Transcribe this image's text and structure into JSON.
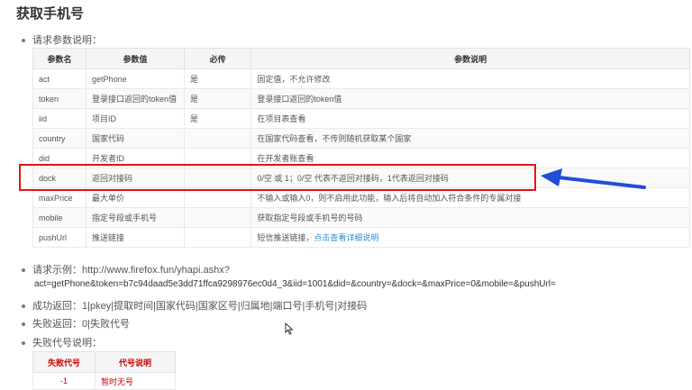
{
  "page_title": "获取手机号",
  "request_params_label": "请求参数说明：",
  "params_table": {
    "headers": [
      "参数名",
      "参数值",
      "必传",
      "参数说明"
    ],
    "rows": [
      {
        "name": "act",
        "value": "getPhone",
        "required": "是",
        "desc": "固定值，不允许修改"
      },
      {
        "name": "token",
        "value": "登录接口返回的token值",
        "required": "是",
        "desc": "登录接口返回的token值"
      },
      {
        "name": "iid",
        "value": "项目ID",
        "required": "是",
        "desc": "在项目表查看"
      },
      {
        "name": "country",
        "value": "国家代码",
        "required": "",
        "desc": "在国家代码查看，不传则随机获取某个国家"
      },
      {
        "name": "did",
        "value": "开发者ID",
        "required": "",
        "desc": "在开发者账查看"
      },
      {
        "name": "dock",
        "value": "返回对接码",
        "required": "",
        "desc": "0/空 或 1；0/空 代表不返回对接码，1代表返回对接码"
      },
      {
        "name": "maxPrice",
        "value": "最大单价",
        "required": "",
        "desc": "不输入或输入0，则不启用此功能，输入后将自动加入符合条件的专属对接"
      },
      {
        "name": "mobile",
        "value": "指定号段或手机号",
        "required": "",
        "desc": "获取指定号段或手机号的号码"
      },
      {
        "name": "pushUrl",
        "value": "推送链接",
        "required": "",
        "desc": "短信推送链接，",
        "link": "点击查看详细说明"
      }
    ]
  },
  "request_example_label": "请求示例：http://www.firefox.fun/yhapi.ashx?",
  "request_example_url": "act=getPhone&token=b7c94daad5e3dd71ffca9298976ec0d4_3&iid=1001&did=&country=&dock=&maxPrice=0&mobile=&pushUrl=",
  "success_return": "成功返回：1|pkey|提取时间|国家代码|国家区号|归属地|端口号|手机号|对接码",
  "failure_return": "失败返回：0|失败代号",
  "failure_code_label": "失败代号说明：",
  "fail_table": {
    "headers": [
      "失败代号",
      "代号说明"
    ],
    "rows": [
      {
        "code": "-1",
        "desc": "暂时无号"
      }
    ]
  },
  "colors": {
    "highlight": "#e01515",
    "arrow": "#1e4fd8",
    "link": "#2b8fd6"
  },
  "icons": {
    "arrow": "left-arrow-icon",
    "cursor": "mouse-cursor-icon"
  }
}
